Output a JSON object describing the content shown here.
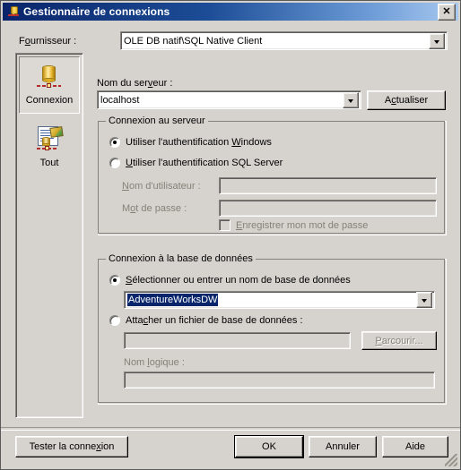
{
  "window": {
    "title": "Gestionnaire de connexions",
    "icon": "database-connection-icon",
    "close_label": "✕"
  },
  "provider": {
    "label_pre": "F",
    "label_accel": "o",
    "label_post": "urnisseur :",
    "label_full": "Fournisseur :",
    "value": "OLE DB natif\\SQL Native Client"
  },
  "sidebar": {
    "items": [
      {
        "label": "Connexion",
        "icon": "database-cylinder-icon",
        "selected": true
      },
      {
        "label": "Tout",
        "icon": "document-properties-icon",
        "selected": false
      }
    ]
  },
  "server": {
    "label_pre": "Nom du ser",
    "label_accel": "v",
    "label_post": "eur :",
    "label_full": "Nom du serveur :",
    "value": "localhost",
    "refresh_pre": "A",
    "refresh_accel": "c",
    "refresh_post": "tualiser",
    "refresh_full": "Actualiser"
  },
  "server_group": {
    "title": "Connexion au serveur",
    "windows_auth": {
      "pre": "Utiliser l'authentification ",
      "accel": "W",
      "post": "indows",
      "full": "Utiliser l'authentification Windows",
      "checked": true
    },
    "sql_auth": {
      "pre": "",
      "accel": "U",
      "post": "tiliser l'authentification SQL Server",
      "full": "Utiliser l'authentification SQL Server",
      "checked": false
    },
    "username": {
      "pre": "",
      "accel": "N",
      "post": "om d'utilisateur :",
      "full": "Nom d'utilisateur :",
      "value": "",
      "disabled": true
    },
    "password": {
      "pre": "M",
      "accel": "o",
      "post": "t de passe :",
      "full": "Mot de passe :",
      "value": "",
      "disabled": true
    },
    "save_password": {
      "pre": "",
      "accel": "E",
      "post": "nregistrer mon mot de passe",
      "full": "Enregistrer mon mot de passe",
      "checked": false,
      "disabled": true
    }
  },
  "database_group": {
    "title": "Connexion à la base de données",
    "select_db": {
      "pre": "",
      "accel": "S",
      "post": "électionner ou entrer un nom de base de données",
      "full": "Sélectionner ou entrer un nom de base de données",
      "checked": true
    },
    "db_combo": {
      "value": "AdventureWorksDW",
      "text_selected": true
    },
    "attach_db": {
      "pre": "Atta",
      "accel": "c",
      "post": "her un fichier de base de données :",
      "full": "Attacher un fichier de base de données :",
      "checked": false
    },
    "attach_file": {
      "value": "",
      "disabled": true
    },
    "browse": {
      "pre": "",
      "accel": "P",
      "post": "arcourir...",
      "full": "Parcourir...",
      "disabled": true
    },
    "logical_name": {
      "pre": "Nom ",
      "accel": "l",
      "post": "ogique :",
      "full": "Nom logique :",
      "value": "",
      "disabled": true
    }
  },
  "footer": {
    "test_pre": "Tester la conne",
    "test_accel": "x",
    "test_post": "ion",
    "test_full": "Tester la connexion",
    "ok": "OK",
    "cancel": "Annuler",
    "help": "Aide"
  },
  "colors": {
    "dialog_face": "#d6d3ce",
    "title_gradient_start": "#0a246a",
    "title_gradient_end": "#a9c9ef",
    "selection_blue": "#08246b",
    "disabled_text": "#868078"
  }
}
